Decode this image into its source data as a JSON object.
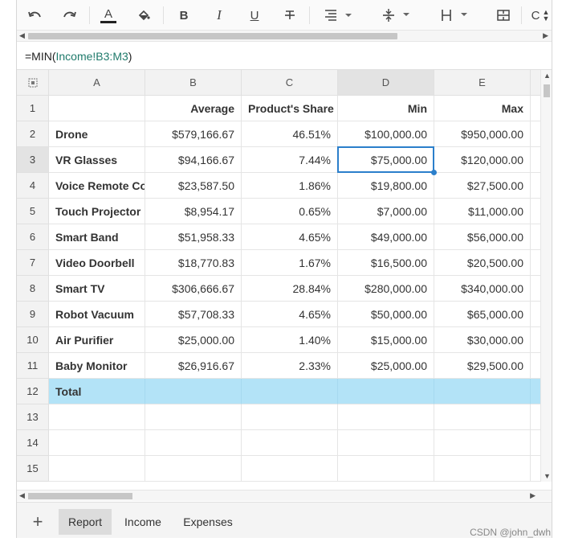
{
  "toolbar": {
    "buttons": [
      "undo-icon",
      "redo-icon",
      "font-color-icon",
      "fill-color-icon",
      "bold-icon",
      "italic-icon",
      "underline-icon",
      "strikethrough-icon",
      "align-icon",
      "vertical-align-icon",
      "wrap-icon",
      "merge-icon"
    ],
    "bold": "B",
    "italic": "I",
    "underline": "U",
    "font_color_letter": "A",
    "truncated": "C"
  },
  "formula": {
    "prefix": "=MIN(",
    "range": "Income!B3:M3",
    "suffix": ")"
  },
  "columns": [
    "A",
    "B",
    "C",
    "D",
    "E"
  ],
  "header_row": {
    "b": "Average",
    "c": "Product's Share",
    "d": "Min",
    "e": "Max"
  },
  "rows": [
    {
      "num": "1"
    },
    {
      "num": "2",
      "a": "Drone",
      "b": "$579,166.67",
      "c": "46.51%",
      "d": "$100,000.00",
      "e": "$950,000.00"
    },
    {
      "num": "3",
      "a": "VR Glasses",
      "b": "$94,166.67",
      "c": "7.44%",
      "d": "$75,000.00",
      "e": "$120,000.00"
    },
    {
      "num": "4",
      "a": "Voice Remote Control",
      "b": "$23,587.50",
      "c": "1.86%",
      "d": "$19,800.00",
      "e": "$27,500.00"
    },
    {
      "num": "5",
      "a": "Touch Projector",
      "b": "$8,954.17",
      "c": "0.65%",
      "d": "$7,000.00",
      "e": "$11,000.00"
    },
    {
      "num": "6",
      "a": "Smart Band",
      "b": "$51,958.33",
      "c": "4.65%",
      "d": "$49,000.00",
      "e": "$56,000.00"
    },
    {
      "num": "7",
      "a": "Video Doorbell",
      "b": "$18,770.83",
      "c": "1.67%",
      "d": "$16,500.00",
      "e": "$20,500.00"
    },
    {
      "num": "8",
      "a": "Smart TV",
      "b": "$306,666.67",
      "c": "28.84%",
      "d": "$280,000.00",
      "e": "$340,000.00"
    },
    {
      "num": "9",
      "a": "Robot Vacuum",
      "b": "$57,708.33",
      "c": "4.65%",
      "d": "$50,000.00",
      "e": "$65,000.00"
    },
    {
      "num": "10",
      "a": "Air Purifier",
      "b": "$25,000.00",
      "c": "1.40%",
      "d": "$15,000.00",
      "e": "$30,000.00"
    },
    {
      "num": "11",
      "a": "Baby Monitor",
      "b": "$26,916.67",
      "c": "2.33%",
      "d": "$25,000.00",
      "e": "$29,500.00"
    },
    {
      "num": "12",
      "a": "Total"
    },
    {
      "num": "13"
    },
    {
      "num": "14"
    },
    {
      "num": "15"
    }
  ],
  "tabs": {
    "add": "+",
    "items": [
      "Report",
      "Income",
      "Expenses"
    ],
    "active": "Report"
  },
  "watermark": "CSDN @john_dwh",
  "colors": {
    "selection": "#2b7fcb",
    "total_row": "#b3e3f7"
  }
}
